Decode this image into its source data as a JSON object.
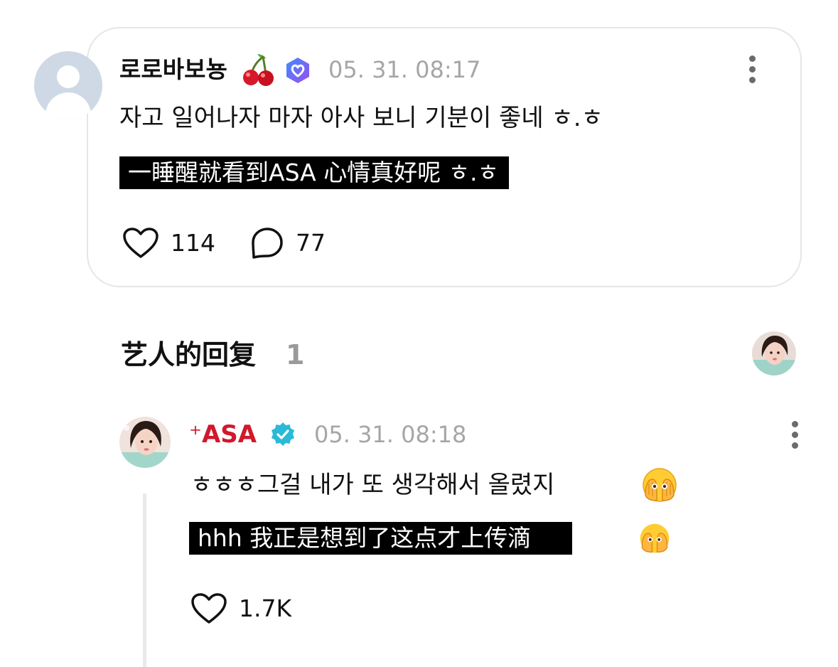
{
  "post": {
    "username": "로로바보뇽",
    "timestamp": "05. 31. 08:17",
    "text": "자고 일어나자 마자 아사 보니 기분이 좋네 ㅎ.ㅎ",
    "translation": "一睡醒就看到ASA 心情真好呢 ㅎ.ㅎ",
    "likes": "114",
    "comments": "77"
  },
  "artist_replies": {
    "title": "艺人的回复",
    "count": "1"
  },
  "reply": {
    "username": "+ASA",
    "username_prefix": "⁺",
    "username_main": "ASA",
    "timestamp": "05. 31. 08:18",
    "text": "ㅎㅎㅎ그걸 내가 또 생각해서 올렸지",
    "translation": "hhh 我正是想到了这点才上传滴",
    "likes": "1.7K"
  },
  "icons": {
    "cherry": "cherry-emoji",
    "fan_badge": "heart-badge-icon",
    "verified": "verified-badge-icon",
    "peek_emoji": "face-with-open-eyes-and-hand-over-mouth-emoji",
    "like": "heart-outline-icon",
    "comment": "comment-bubble-icon",
    "more": "more-vertical-icon"
  },
  "colors": {
    "artist_name": "#d1182d",
    "verified": "#2bb9d9",
    "fan_badge": "#6a5cf2",
    "muted_text": "#a6a6a6",
    "card_border": "#e6e6e6"
  }
}
